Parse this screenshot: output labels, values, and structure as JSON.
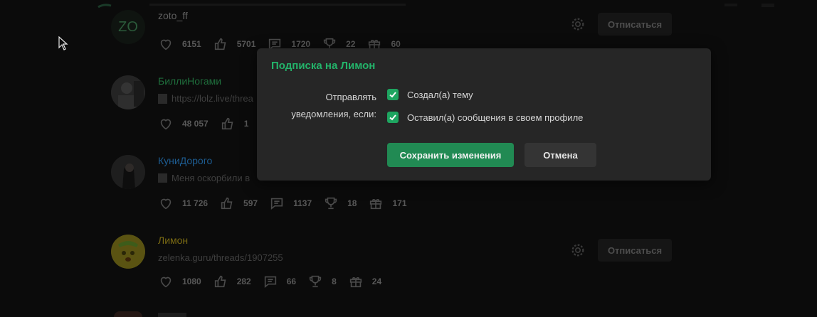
{
  "feed": {
    "items": [
      {
        "avatar_text": "ZO",
        "username": "zoto_ff",
        "username_color": "#5f5f5f",
        "subline": "",
        "stats": [
          "6151",
          "5701",
          "1720",
          "22",
          "60"
        ],
        "show_actions": true
      },
      {
        "avatar_text": "",
        "username": "БиллиНогами",
        "username_color": "#1f6e3c",
        "subline": "https://lolz.live/threa",
        "stats": [
          "48 057",
          "1"
        ],
        "show_actions": false
      },
      {
        "avatar_text": "",
        "username": "КуниДорого",
        "username_color": "#1d5c91",
        "subline": "Меня оскорбили в",
        "stats": [
          "11 726",
          "597",
          "1137",
          "18",
          "171"
        ],
        "show_actions": false
      },
      {
        "avatar_text": "",
        "username": "Лимон",
        "username_color": "#7a6a13",
        "subline": "zelenka.guru/threads/1907255",
        "stats": [
          "1080",
          "282",
          "66",
          "8",
          "24"
        ],
        "show_actions": true
      }
    ],
    "unsubscribe_label": "Отписаться"
  },
  "modal": {
    "title": "Подписка на Лимон",
    "label": "Отправлять уведомления, если:",
    "options": [
      {
        "label": "Создал(а) тему",
        "checked": true
      },
      {
        "label": "Оставил(а) сообщения в своем профиле",
        "checked": true
      }
    ],
    "save_label": "Сохранить изменения",
    "cancel_label": "Отмена"
  },
  "colors": {
    "accent": "#23b36a",
    "checkbox": "#1ea560",
    "save_button": "#218a53"
  }
}
